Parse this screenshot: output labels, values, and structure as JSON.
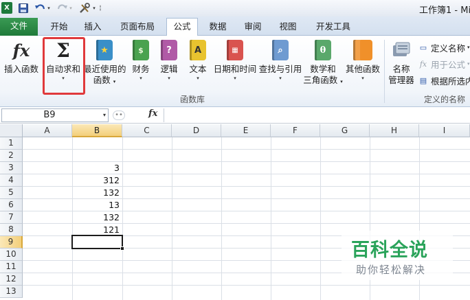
{
  "window": {
    "title": "工作簿1 - Mi"
  },
  "qat": {
    "sep": "¦",
    "dd": "▾"
  },
  "tabs": [
    {
      "label": "文件"
    },
    {
      "label": "开始"
    },
    {
      "label": "插入"
    },
    {
      "label": "页面布局"
    },
    {
      "label": "公式"
    },
    {
      "label": "数据"
    },
    {
      "label": "审阅"
    },
    {
      "label": "视图"
    },
    {
      "label": "开发工具"
    }
  ],
  "active_tab": "公式",
  "ribbon": {
    "insert_function": {
      "label": "插入函数",
      "icon_text": "fx"
    },
    "autosum": {
      "label": "自动求和",
      "icon_text": "Σ"
    },
    "recent": {
      "label": "最近使用的",
      "label2": "函数"
    },
    "financial": {
      "label": "财务"
    },
    "logical": {
      "label": "逻辑",
      "icon_text": "?"
    },
    "text": {
      "label": "文本",
      "icon_text": "A"
    },
    "datetime": {
      "label": "日期和时间"
    },
    "lookup": {
      "label": "查找与引用"
    },
    "math": {
      "label": "数学和",
      "label2": "三角函数",
      "icon_text": "θ"
    },
    "more": {
      "label": "其他函数"
    },
    "name_manager": {
      "label": "名称",
      "label2": "管理器"
    },
    "define_name": {
      "label": "定义名称"
    },
    "use_in_formula": {
      "label": "用于公式"
    },
    "create_from_selection": {
      "label": "根据所选内"
    },
    "group_function_library": "函数库",
    "group_defined_names": "定义的名称",
    "dropdown_glyph": "▾",
    "fx_small": "fx"
  },
  "formula_bar": {
    "name_box": "B9",
    "fx": "fx",
    "dots": "••",
    "formula": "",
    "dd": "▾"
  },
  "grid": {
    "columns": [
      "A",
      "B",
      "C",
      "D",
      "E",
      "F",
      "G",
      "H",
      "I"
    ],
    "selected_column": "B",
    "rows": [
      "1",
      "2",
      "3",
      "4",
      "5",
      "6",
      "7",
      "8",
      "9",
      "10",
      "11",
      "12",
      "13"
    ],
    "selected_row": "9",
    "cells": [
      {
        "ref": "B3",
        "value": "3"
      },
      {
        "ref": "B4",
        "value": "312"
      },
      {
        "ref": "B5",
        "value": "132"
      },
      {
        "ref": "B6",
        "value": "13"
      },
      {
        "ref": "B7",
        "value": "132"
      },
      {
        "ref": "B8",
        "value": "121"
      }
    ]
  },
  "watermark": {
    "title": "百科全说",
    "subtitle": "助你轻松解决"
  },
  "colors": {
    "file_tab": "#1f7a3a",
    "highlight": "#e0393b",
    "selected_header": "#f3cf7a",
    "watermark_green": "#2aa35a"
  }
}
